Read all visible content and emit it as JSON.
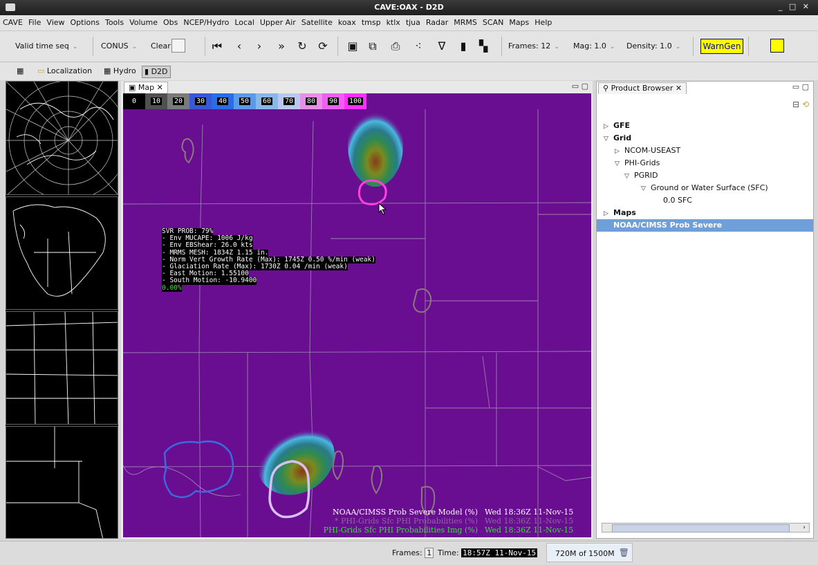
{
  "window": {
    "title": "CAVE:OAX - D2D",
    "controls": "_ □ ✕"
  },
  "menu": {
    "items": [
      "CAVE",
      "File",
      "View",
      "Options",
      "Tools",
      "Volume",
      "Obs",
      "NCEP/Hydro",
      "Local",
      "Upper Air",
      "Satellite",
      "koax",
      "tmsp",
      "ktlx",
      "tjua",
      "Radar",
      "MRMS",
      "SCAN",
      "Maps",
      "Help"
    ]
  },
  "toolbar": {
    "valid_time": "Valid time seq",
    "scale": "CONUS",
    "clear": "Clear",
    "frames": "Frames: 12",
    "mag": "Mag: 1.0",
    "density": "Density: 1.0",
    "warngen": "WarnGen",
    "icons": [
      "first-frame-icon",
      "step-back-icon",
      "step-forward-icon",
      "last-frame-icon",
      "loop-icon",
      "rock-icon",
      "image-properties-icon",
      "zoom-icon",
      "print-icon",
      "points-icon",
      "baselines-icon",
      "single-panel-icon",
      "four-panel-icon",
      "alert-icon"
    ]
  },
  "perspectives": {
    "localization": "Localization",
    "hydro": "Hydro",
    "d2d": "D2D"
  },
  "map": {
    "tab": "Map",
    "colorbar": [
      "0",
      "10",
      "20",
      "30",
      "40",
      "50",
      "60",
      "70",
      "80",
      "90",
      "100"
    ],
    "colorbar_colors": [
      "#000000",
      "#505050",
      "#7a7a7a",
      "#3858d8",
      "#2a6ce8",
      "#5a9ae8",
      "#88b8e8",
      "#b8c8f0",
      "#e890e8",
      "#f060f0",
      "#ff30ff"
    ],
    "background_color": "#6a0e91",
    "sample": {
      "lines": [
        "SVR PROB: 79%",
        "- Env MUCAPE: 1006 J/kg",
        "- Env EBShear: 26.0 kts",
        "- MRMS MESH: 1834Z 1.15 in.",
        "- Norm Vert Growth Rate (Max): 1745Z 0.50 %/min (weak)",
        "- Glaciation Rate (Max): 1730Z 0.04 /min (weak)",
        "- East Motion: 1.55100",
        "- South Motion: -10.9400"
      ],
      "pct": "0.00%"
    },
    "legend": [
      {
        "name": "NOAA/CIMSS Prob Severe Model (%)",
        "time": "Wed 18:36Z 11-Nov-15"
      },
      {
        "name": "* PHI-Grids Sfc PHI Probabilities (%)",
        "time": "Wed 18:36Z 11-Nov-15"
      },
      {
        "name": "PHI-Grids Sfc PHI Probabilities Img (%)",
        "time": "Wed 18:36Z 11-Nov-15"
      }
    ]
  },
  "product_browser": {
    "tab": "Product Browser",
    "tree": {
      "gfe": "GFE",
      "grid": "Grid",
      "ncom": "NCOM-USEAST",
      "phi": "PHI-Grids",
      "pgrid": "PGRID",
      "sfc_level": "Ground or Water Surface (SFC)",
      "sfc_value": "0.0 SFC",
      "maps": "Maps",
      "prob_severe": "NOAA/CIMSS Prob Severe"
    }
  },
  "status": {
    "frames_label": "Frames:",
    "frames_value": "1",
    "time_label": "Time:",
    "time_value": "18:57Z 11-Nov-15",
    "memory": "720M of 1500M"
  }
}
